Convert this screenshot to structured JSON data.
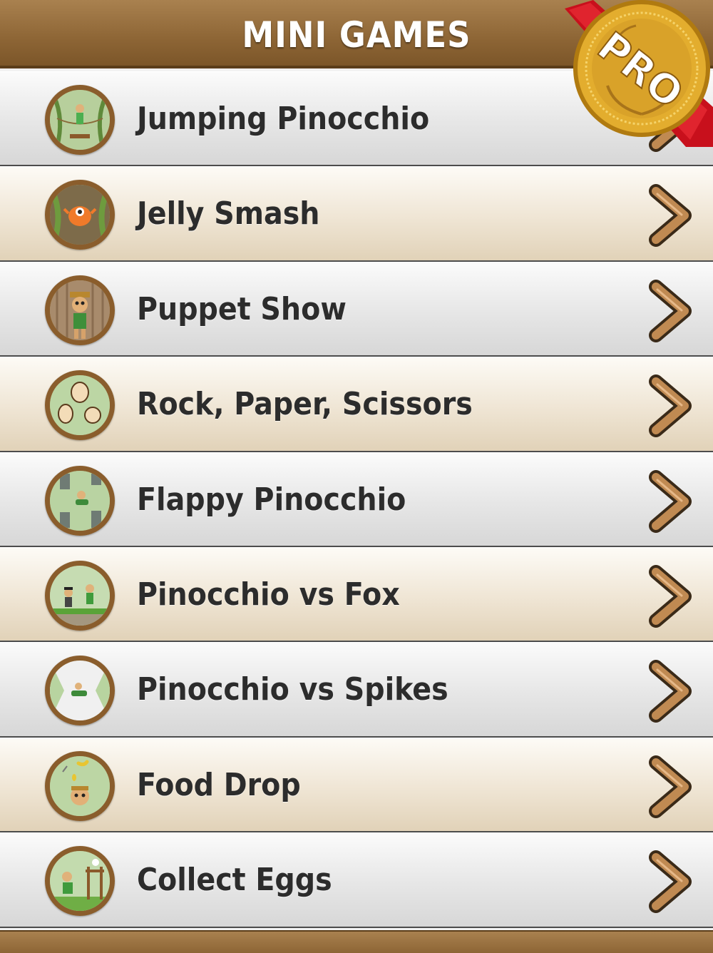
{
  "header": {
    "title": "MINI GAMES"
  },
  "badge": {
    "text": "PRO"
  },
  "games": [
    {
      "title": "Jumping Pinocchio",
      "icon": "jumping-pinocchio-icon"
    },
    {
      "title": "Jelly Smash",
      "icon": "jelly-smash-icon"
    },
    {
      "title": "Puppet Show",
      "icon": "puppet-show-icon"
    },
    {
      "title": "Rock, Paper, Scissors",
      "icon": "rock-paper-scissors-icon"
    },
    {
      "title": "Flappy Pinocchio",
      "icon": "flappy-pinocchio-icon"
    },
    {
      "title": "Pinocchio vs Fox",
      "icon": "pinocchio-vs-fox-icon"
    },
    {
      "title": "Pinocchio vs Spikes",
      "icon": "pinocchio-vs-spikes-icon"
    },
    {
      "title": "Food Drop",
      "icon": "food-drop-icon"
    },
    {
      "title": "Collect Eggs",
      "icon": "collect-eggs-icon"
    }
  ],
  "colors": {
    "header_brown": "#8d6535",
    "chevron_brown": "#b07a44",
    "badge_gold": "#d9a629",
    "ribbon_red": "#c8101c"
  }
}
